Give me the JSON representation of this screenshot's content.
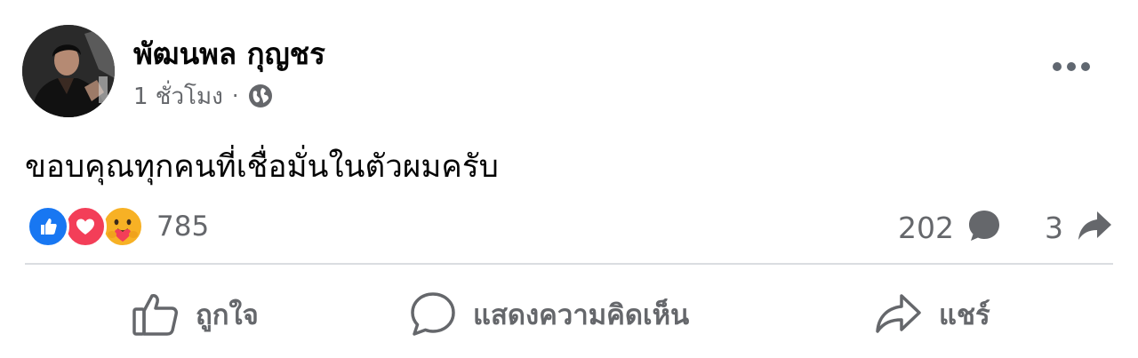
{
  "post": {
    "author": "พัฒนพล กุญชร",
    "time": "1 ชั่วโมง",
    "separator": "·",
    "message": "ขอบคุณทุกคนที่เชื่อมั่นในตัวผมครับ",
    "audience_icon": "globe-icon",
    "more_icon": "more-options-icon"
  },
  "reactions": {
    "types": [
      "like",
      "love",
      "care"
    ],
    "count": "785"
  },
  "stats": {
    "comments": "202",
    "shares": "3"
  },
  "actions": {
    "like": "ถูกใจ",
    "comment": "แสดงความคิดเห็น",
    "share": "แชร์"
  },
  "colors": {
    "like_blue": "#1877f2",
    "love_red": "#f33e58",
    "care_yellow": "#f7b125",
    "secondary_text": "#65676b",
    "divider": "#dadde1"
  }
}
